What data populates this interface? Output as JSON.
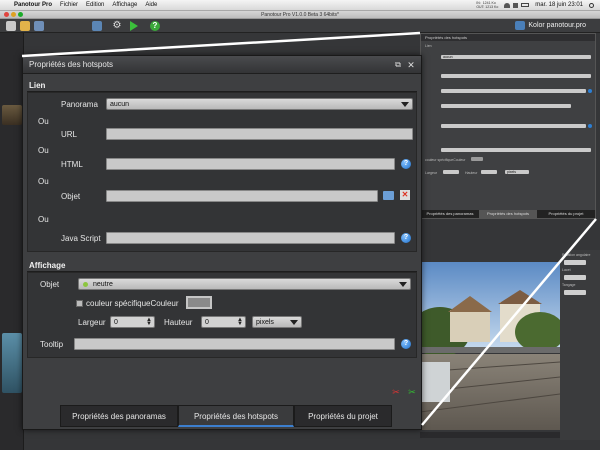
{
  "menubar": {
    "app_name": "Panotour Pro",
    "items": [
      "Fichier",
      "Edition",
      "Affichage",
      "Aide"
    ],
    "net_stats": "IN:  1241 Ko\nOUT: 1213 Ko",
    "clock": "mar. 18 juin  23:01"
  },
  "window": {
    "title": "Panotour Pro V1.0.0 Beta 3 64bits*"
  },
  "toolbar": {
    "brand": "Kolor panotour.pro"
  },
  "inset": {
    "title": "Propriétés des hotspots",
    "section": "Lien",
    "select_value": "aucun",
    "label_couleur": "couleur spécifiqueCouleur",
    "label_largeur": "Largeur",
    "label_hauteur": "Hauteur",
    "unit": "pixels",
    "tabs": [
      "Propriétés des panoramas",
      "Propriétés des hotspots",
      "Propriétés du projet"
    ]
  },
  "right_panel": {
    "labels": [
      "Rotation angulaire",
      "Lacet",
      "Tangage"
    ]
  },
  "dialog": {
    "title": "Propriétés des hotspots",
    "lien": {
      "heading": "Lien",
      "panorama_label": "Panorama",
      "panorama_value": "aucun",
      "ou_1": "Ou",
      "url_label": "URL",
      "url_value": "",
      "ou_2": "Ou",
      "html_label": "HTML",
      "html_value": "",
      "ou_3": "Ou",
      "objet_label": "Objet",
      "objet_value": "",
      "ou_4": "Ou",
      "javascript_label": "Java Script",
      "javascript_value": ""
    },
    "affichage": {
      "heading": "Affichage",
      "objet_label": "Objet",
      "objet_value": "neutre",
      "couleur_label": "couleur spécifiqueCouleur",
      "couleur_checked": false,
      "couleur_swatch": "#8a8a8a",
      "largeur_label": "Largeur",
      "largeur_value": "0",
      "hauteur_label": "Hauteur",
      "hauteur_value": "0",
      "unit_value": "pixels",
      "tooltip_label": "Tooltip",
      "tooltip_value": ""
    },
    "tabs": [
      "Propriétés des panoramas",
      "Propriétés des hotspots",
      "Propriétés du projet"
    ],
    "active_tab": 1
  },
  "colors": {
    "accent": "#3c7fcf",
    "help": "#1f6fc9",
    "neutre_dot": "#8cc63f"
  }
}
